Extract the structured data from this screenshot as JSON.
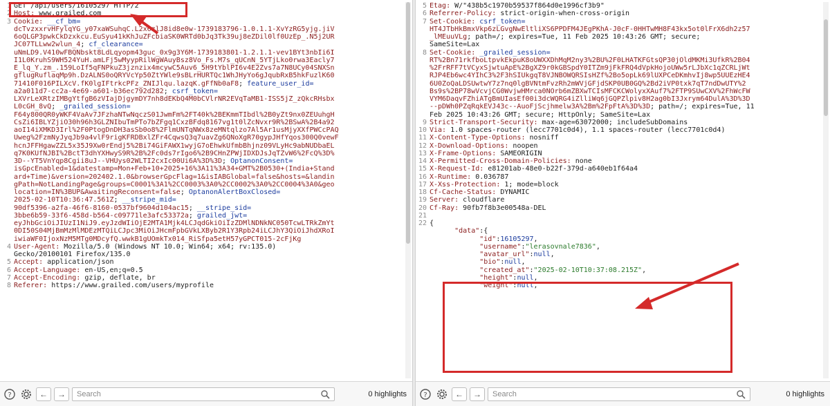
{
  "left_panel": {
    "lines": [
      {
        "n": "1",
        "segs": [
          {
            "c": "p",
            "t": "GET /api/users/16105297 HTTP/2"
          }
        ]
      },
      {
        "n": "2",
        "segs": [
          {
            "c": "k",
            "t": "Host: "
          },
          {
            "c": "p",
            "t": "www.grailed.com"
          }
        ]
      },
      {
        "n": "3",
        "segs": [
          {
            "c": "k",
            "t": "Cookie: "
          },
          {
            "c": "ck",
            "t": "__cf_bm="
          }
        ]
      },
      {
        "n": "",
        "segs": [
          {
            "c": "v",
            "t": "dcTvzxxrvHFylqYG_y07xaWSuhqC.L2x6zlJ8id8e0w-1739183796-1.0.1.1-XvYzRG5yjg.jiV"
          }
        ]
      },
      {
        "n": "",
        "segs": [
          {
            "c": "v",
            "t": "6oQLGP3pwkCkDzxkcu.EuSyu41kKhJuZFcbiaSK0WRTd0bJq3Tk39uj8eZDil0lf0UzEp_.N5j2UR"
          }
        ]
      },
      {
        "n": "",
        "segs": [
          {
            "c": "v",
            "t": "JC07TLLww2wlun_4"
          },
          {
            "c": "p",
            "t": "; "
          },
          {
            "c": "ck",
            "t": "cf_clearance="
          }
        ]
      },
      {
        "n": "",
        "segs": [
          {
            "c": "v",
            "t": "uNmLD9.V410wFBQNbskt8LdLqyopm43guc_0x9g3Y6M-1739183801-1.2.1.1-vev1BYt3nbIi6I"
          }
        ]
      },
      {
        "n": "",
        "segs": [
          {
            "c": "v",
            "t": "I1L0KruhS9WH524YuH.amLFj5wMyypRilWgWAuyBsz8Vo_Fs.M7s_qUCnN_5YTjLko0rwa3Eacly7"
          }
        ]
      },
      {
        "n": "",
        "segs": [
          {
            "c": "v",
            "t": "E_lq_Y.zm_.159LoIf5qFNPkuZ3jznzix4mcywC5Auv6_5H9tYblPI6v4E2Zvs7a7N8UCy04SNXSn"
          }
        ]
      },
      {
        "n": "",
        "segs": [
          {
            "c": "v",
            "t": "gflugRuflaqMp9h.DzALNS0oQRYVcYp50ZtYWle9sBLrHURTQc1WhJHyYo6gJqubRxB5hkFuzlK60"
          }
        ]
      },
      {
        "n": "",
        "segs": [
          {
            "c": "v",
            "t": "71410F016PILXcV.fK0lgIFtrkcPFz_ZNIJlqu.lazqK.gFfNb0aF8"
          },
          {
            "c": "p",
            "t": "; "
          },
          {
            "c": "ck",
            "t": "feature_user_id="
          }
        ]
      },
      {
        "n": "",
        "segs": [
          {
            "c": "v",
            "t": "a2a011d7-cc2a-4e69-a601-b36ec792d282"
          },
          {
            "c": "p",
            "t": "; "
          },
          {
            "c": "ck",
            "t": "csrf_token="
          }
        ]
      },
      {
        "n": "",
        "segs": [
          {
            "c": "v",
            "t": "LXVrLeXRtzIMBgYtfgB6zVIajDjgymDY7nh8dEKbQ4M0bCVlrNR2EVqTaMB1-ISS5jZ_zQkcRHsbx"
          }
        ]
      },
      {
        "n": "",
        "segs": [
          {
            "c": "v",
            "t": "L0cGH_8vQ"
          },
          {
            "c": "p",
            "t": "; "
          },
          {
            "c": "ck",
            "t": "_grailed_session="
          }
        ]
      },
      {
        "n": "",
        "segs": [
          {
            "c": "v",
            "t": "F64y800QR0yWKF4VaAv7JFzhaNTwNqczS01JwmFm%2FT40k%2BEKmmTIbdl%2B0yZt9nx0ZEUuhgH"
          }
        ]
      },
      {
        "n": "",
        "segs": [
          {
            "c": "v",
            "t": "CsZi6IBLYZjiO30h96h3GLZNIbuTmPTo7bZFgq1CxzBFdq8167vg1t0lZcNvxr9R%2BSwA%2B4a92"
          }
        ]
      },
      {
        "n": "",
        "segs": [
          {
            "c": "v",
            "t": "aoI14iXMKD3Irl%2F0PtogDnDH3asSb0o8%2FlmUNTqNWx8zeMNtqlzo7Al5Ar1usMjyXXfPWCcPAQ"
          }
        ]
      },
      {
        "n": "",
        "segs": [
          {
            "c": "v",
            "t": "Uweg%2FzmNyJyqJb9a4vlF9rigKFRDBxlZFr4CqwsQ3q7uavZg6QNoXgR70gypJHfYqos300Q0vewF"
          }
        ]
      },
      {
        "n": "",
        "segs": [
          {
            "c": "v",
            "t": "hcnJFFHgawZZL5x35J9Xw0rEndj5%2Bi74GiFAWX1wyjG7oEhwkUfmbBhjnz09VLyHc9abNUDbaEL"
          }
        ]
      },
      {
        "n": "",
        "segs": [
          {
            "c": "v",
            "t": "q7K0KUfNJBI%2BctT3dhYXHwyS9R%2B%2Fc0ds7rIgo6%2B9CHnZPWjIDXDJsJqTZvW6%2FcQ%3D%"
          }
        ]
      },
      {
        "n": "",
        "segs": [
          {
            "c": "v",
            "t": "3D--YT5VnYqp8Cgii8uJ--VHUys02WLTI2cxIc00Ui6A%3D%3D"
          },
          {
            "c": "p",
            "t": "; "
          },
          {
            "c": "ck",
            "t": "OptanonConsent="
          }
        ]
      },
      {
        "n": "",
        "segs": [
          {
            "c": "v",
            "t": "isGpcEnabled=1&datestamp=Mon+Feb+10+2025+16%3A11%3A34+GMT%2B0530+(India+Stand"
          }
        ]
      },
      {
        "n": "",
        "segs": [
          {
            "c": "v",
            "t": "ard+Time)&version=202402.1.0&browserGpcFlag=1&isIABGlobal=false&hosts=&landin"
          }
        ]
      },
      {
        "n": "",
        "segs": [
          {
            "c": "v",
            "t": "gPath=NotLandingPage&groups=C0001%3A1%2CC0003%3A0%2CC0002%3A0%2CC0004%3A0&geo"
          }
        ]
      },
      {
        "n": "",
        "segs": [
          {
            "c": "v",
            "t": "location=IN%3BUP&AwaitingReconsent=false"
          },
          {
            "c": "p",
            "t": "; "
          },
          {
            "c": "ck",
            "t": "OptanonAlertBoxClosed="
          }
        ]
      },
      {
        "n": "",
        "segs": [
          {
            "c": "v",
            "t": "2025-02-10T10:36:47.561Z"
          },
          {
            "c": "p",
            "t": "; "
          },
          {
            "c": "ck",
            "t": "__stripe_mid="
          }
        ]
      },
      {
        "n": "",
        "segs": [
          {
            "c": "v",
            "t": "90df5396-a2fa-46f6-8160-0537bf9604d104ac15"
          },
          {
            "c": "p",
            "t": "; "
          },
          {
            "c": "ck",
            "t": "__stripe_sid="
          }
        ]
      },
      {
        "n": "",
        "segs": [
          {
            "c": "v",
            "t": "3bbe6b59-33f6-458d-b564-c09771le3afc53372a"
          },
          {
            "c": "p",
            "t": "; "
          },
          {
            "c": "ck",
            "t": "grailed_jwt="
          }
        ]
      },
      {
        "n": "",
        "segs": [
          {
            "c": "v",
            "t": "eyJhbGciOiJIUzI1NiJ9.eyJzdWIiOjE2MTA1Mjk4LCJqdGkiOiIzZDMlNDNkNC050TcwLTRkZmYt"
          }
        ]
      },
      {
        "n": "",
        "segs": [
          {
            "c": "v",
            "t": "0DI50S04MjBmMzMlMDEzMTQiLCJpc3MiOiJHcmFpbGVkLXByb2R1Y3Rpb24iLCJhY3QiOiJhdXRoI"
          }
        ]
      },
      {
        "n": "",
        "segs": [
          {
            "c": "v",
            "t": "iwiaWF0IjoxNzM5MTg0MDcyfQ.wwkB1gUOmkTx014_RiSfpa5etH57yGPCT015-2cFjKg"
          }
        ]
      },
      {
        "n": "4",
        "segs": [
          {
            "c": "k",
            "t": "User-Agent: "
          },
          {
            "c": "p",
            "t": "Mozilla/5.0 (Windows NT 10.0; Win64; x64; rv:135.0)"
          }
        ]
      },
      {
        "n": "",
        "segs": [
          {
            "c": "p",
            "t": "Gecko/20100101 Firefox/135.0"
          }
        ]
      },
      {
        "n": "5",
        "segs": [
          {
            "c": "k",
            "t": "Accept: "
          },
          {
            "c": "p",
            "t": "application/json"
          }
        ]
      },
      {
        "n": "6",
        "segs": [
          {
            "c": "k",
            "t": "Accept-Language: "
          },
          {
            "c": "p",
            "t": "en-US,en;q=0.5"
          }
        ]
      },
      {
        "n": "7",
        "segs": [
          {
            "c": "k",
            "t": "Accept-Encoding: "
          },
          {
            "c": "p",
            "t": "gzip, deflate, br"
          }
        ]
      },
      {
        "n": "8",
        "segs": [
          {
            "c": "k",
            "t": "Referer: "
          },
          {
            "c": "p",
            "t": "https://www.grailed.com/users/myprofile"
          }
        ]
      }
    ],
    "search_placeholder": "Search",
    "highlights": "0 highlights"
  },
  "right_panel": {
    "lines": [
      {
        "n": "5",
        "segs": [
          {
            "c": "k",
            "t": "Etag: "
          },
          {
            "c": "p",
            "t": "W/\"438b5c1970b59537f864d0e1996cf3b9\""
          }
        ]
      },
      {
        "n": "6",
        "segs": [
          {
            "c": "k",
            "t": "Referrer-Policy: "
          },
          {
            "c": "p",
            "t": "strict-origin-when-cross-origin"
          }
        ]
      },
      {
        "n": "7",
        "segs": [
          {
            "c": "k",
            "t": "Set-Cookie: "
          },
          {
            "c": "ck",
            "t": "csrf_token="
          }
        ]
      },
      {
        "n": "",
        "segs": [
          {
            "c": "v",
            "t": "HT4JTbHkBmxVkp6zLGvgNwEltliXS6PPDFM4JEgPKhA-J0cF-0HHTwMH8F43kx5ot0lFrX6dh2z57"
          }
        ]
      },
      {
        "n": "",
        "segs": [
          {
            "c": "v",
            "t": "_lMEuuVLg"
          },
          {
            "c": "p",
            "t": "; path=/; expires=Tue, 11 Feb 2025 10:43:26 GMT; secure;"
          }
        ]
      },
      {
        "n": "",
        "segs": [
          {
            "c": "p",
            "t": "SameSite=Lax"
          }
        ]
      },
      {
        "n": "8",
        "segs": [
          {
            "c": "k",
            "t": "Set-Cookie: "
          },
          {
            "c": "ck",
            "t": "_grailed_session="
          }
        ]
      },
      {
        "n": "",
        "segs": [
          {
            "c": "v",
            "t": "RT%2Bn71rkfboLtpvkEkpuK8oUWXXDhMqM2ny3%2BU%2F0LHATKFGtsQP30jOldMKMi3UfkR%2B04"
          }
        ]
      },
      {
        "n": "",
        "segs": [
          {
            "c": "v",
            "t": "%2FrRFF7tVCyxSjwtuApE%2BgXZ9r0kGBSpdY0ITZm9jFkFRQ4dVpkHojoUWw5rLJbXc1qZCRLjWt"
          }
        ]
      },
      {
        "n": "",
        "segs": [
          {
            "c": "v",
            "t": "RJP4Eb6wc4YIhC3%2F3hSIUkgqT8VJNBOWQRSIsHZf%2Bo5opLk69lUXPCeDKmhvIj8wp5UUEzHE4"
          }
        ]
      },
      {
        "n": "",
        "segs": [
          {
            "c": "v",
            "t": "6U0ZoQaLDSUwtwY7z7nq0lgBVNtmFvzRh2mWVjGFjdSKP0UB0GQ%2Bd2iVP0txk7qT7ndDwUTY%2"
          }
        ]
      },
      {
        "n": "",
        "segs": [
          {
            "c": "v",
            "t": "Bs9s%2BP78wVcvjCG0WvjwHMrca0NOrb6mZBXwTCIsMFCKCWolyxXAuf7%2FTP9SUwCXV%2FhWcFW"
          }
        ]
      },
      {
        "n": "",
        "segs": [
          {
            "c": "v",
            "t": "VYM6DaqvFZhiATgBmUIasEf00i3dcWQRG4iZlliWq6jGQPZlpiv8H2ag0bI3Jxrym64DulA%3D%3D"
          }
        ]
      },
      {
        "n": "",
        "segs": [
          {
            "c": "v",
            "t": "--pDWh0PZqRqkEVJ43c--AuoFjScjhmelw3A%2Bm%2FpFtA%3D%3D"
          },
          {
            "c": "p",
            "t": "; path=/; expires=Tue, 11"
          }
        ]
      },
      {
        "n": "",
        "segs": [
          {
            "c": "p",
            "t": "Feb 2025 10:43:26 GMT; secure; HttpOnly; SameSite=Lax"
          }
        ]
      },
      {
        "n": "9",
        "segs": [
          {
            "c": "k",
            "t": "Strict-Transport-Security: "
          },
          {
            "c": "p",
            "t": "max-age=63072000; includeSubDomains"
          }
        ]
      },
      {
        "n": "10",
        "segs": [
          {
            "c": "k",
            "t": "Via: "
          },
          {
            "c": "p",
            "t": "1.0 spaces-router (lecc7701c0d4), 1.1 spaces-router (lecc7701c0d4)"
          }
        ]
      },
      {
        "n": "11",
        "segs": [
          {
            "c": "k",
            "t": "X-Content-Type-Options: "
          },
          {
            "c": "p",
            "t": "nosniff"
          }
        ]
      },
      {
        "n": "12",
        "segs": [
          {
            "c": "k",
            "t": "X-Download-Options: "
          },
          {
            "c": "p",
            "t": "noopen"
          }
        ]
      },
      {
        "n": "13",
        "segs": [
          {
            "c": "k",
            "t": "X-Frame-Options: "
          },
          {
            "c": "p",
            "t": "SAMEORIGIN"
          }
        ]
      },
      {
        "n": "14",
        "segs": [
          {
            "c": "k",
            "t": "X-Permitted-Cross-Domain-Policies: "
          },
          {
            "c": "p",
            "t": "none"
          }
        ]
      },
      {
        "n": "15",
        "segs": [
          {
            "c": "k",
            "t": "X-Request-Id: "
          },
          {
            "c": "p",
            "t": "e81201ab-48e0-b22f-379d-a640eb1f64a4"
          }
        ]
      },
      {
        "n": "16",
        "segs": [
          {
            "c": "k",
            "t": "X-Runtime: "
          },
          {
            "c": "p",
            "t": "0.036787"
          }
        ]
      },
      {
        "n": "17",
        "segs": [
          {
            "c": "k",
            "t": "X-Xss-Protection: "
          },
          {
            "c": "p",
            "t": "1; mode=block"
          }
        ]
      },
      {
        "n": "18",
        "segs": [
          {
            "c": "k",
            "t": "Cf-Cache-Status: "
          },
          {
            "c": "p",
            "t": "DYNAMIC"
          }
        ]
      },
      {
        "n": "19",
        "segs": [
          {
            "c": "k",
            "t": "Server: "
          },
          {
            "c": "p",
            "t": "cloudflare"
          }
        ]
      },
      {
        "n": "20",
        "segs": [
          {
            "c": "k",
            "t": "Cf-Ray: "
          },
          {
            "c": "p",
            "t": "90fb7f8b3e00548a-DEL"
          }
        ]
      },
      {
        "n": "21",
        "segs": [
          {
            "c": "p",
            "t": ""
          }
        ]
      },
      {
        "n": "22",
        "segs": [
          {
            "c": "p",
            "t": "{"
          }
        ]
      },
      {
        "n": "",
        "segs": [
          {
            "c": "p",
            "t": "      "
          },
          {
            "c": "js-key",
            "t": "\"data\""
          },
          {
            "c": "p",
            "t": ":{"
          }
        ]
      },
      {
        "n": "",
        "segs": [
          {
            "c": "p",
            "t": "            "
          },
          {
            "c": "js-key",
            "t": "\"id\""
          },
          {
            "c": "p",
            "t": ":"
          },
          {
            "c": "js-num",
            "t": "16105297"
          },
          {
            "c": "p",
            "t": ","
          }
        ]
      },
      {
        "n": "",
        "segs": [
          {
            "c": "p",
            "t": "            "
          },
          {
            "c": "js-key",
            "t": "\"username\""
          },
          {
            "c": "p",
            "t": ":"
          },
          {
            "c": "js-str",
            "t": "\"lerasovnale7836\""
          },
          {
            "c": "p",
            "t": ","
          }
        ]
      },
      {
        "n": "",
        "segs": [
          {
            "c": "p",
            "t": "            "
          },
          {
            "c": "js-key",
            "t": "\"avatar_url\""
          },
          {
            "c": "p",
            "t": ":"
          },
          {
            "c": "js-null",
            "t": "null"
          },
          {
            "c": "p",
            "t": ","
          }
        ]
      },
      {
        "n": "",
        "segs": [
          {
            "c": "p",
            "t": "            "
          },
          {
            "c": "js-key",
            "t": "\"bio\""
          },
          {
            "c": "p",
            "t": ":"
          },
          {
            "c": "js-null",
            "t": "null"
          },
          {
            "c": "p",
            "t": ","
          }
        ]
      },
      {
        "n": "",
        "segs": [
          {
            "c": "p",
            "t": "            "
          },
          {
            "c": "js-key",
            "t": "\"created_at\""
          },
          {
            "c": "p",
            "t": ":"
          },
          {
            "c": "js-str",
            "t": "\"2025-02-10T10:37:08.215Z\""
          },
          {
            "c": "p",
            "t": ","
          }
        ]
      },
      {
        "n": "",
        "segs": [
          {
            "c": "p",
            "t": "            "
          },
          {
            "c": "js-key",
            "t": "\"height\""
          },
          {
            "c": "p",
            "t": ":"
          },
          {
            "c": "js-null",
            "t": "null"
          },
          {
            "c": "p",
            "t": ","
          }
        ]
      },
      {
        "n": "",
        "segs": [
          {
            "c": "p",
            "t": "            "
          },
          {
            "c": "js-key",
            "t": "\"weight\""
          },
          {
            "c": "p",
            "t": ":"
          },
          {
            "c": "js-null",
            "t": "null"
          },
          {
            "c": "p",
            "t": ","
          }
        ]
      }
    ],
    "search_placeholder": "Search",
    "highlights": "0 highlights"
  },
  "colors": {
    "header_key": "#8a1c1c",
    "cookie_key": "#1c3c9e",
    "json_string": "#2a7a2a",
    "annotation_red": "#d42a2a"
  },
  "icons": {
    "help": "help-icon",
    "settings": "gear-icon",
    "back": "arrow-left-icon",
    "forward": "arrow-right-icon",
    "search": "search-icon"
  }
}
